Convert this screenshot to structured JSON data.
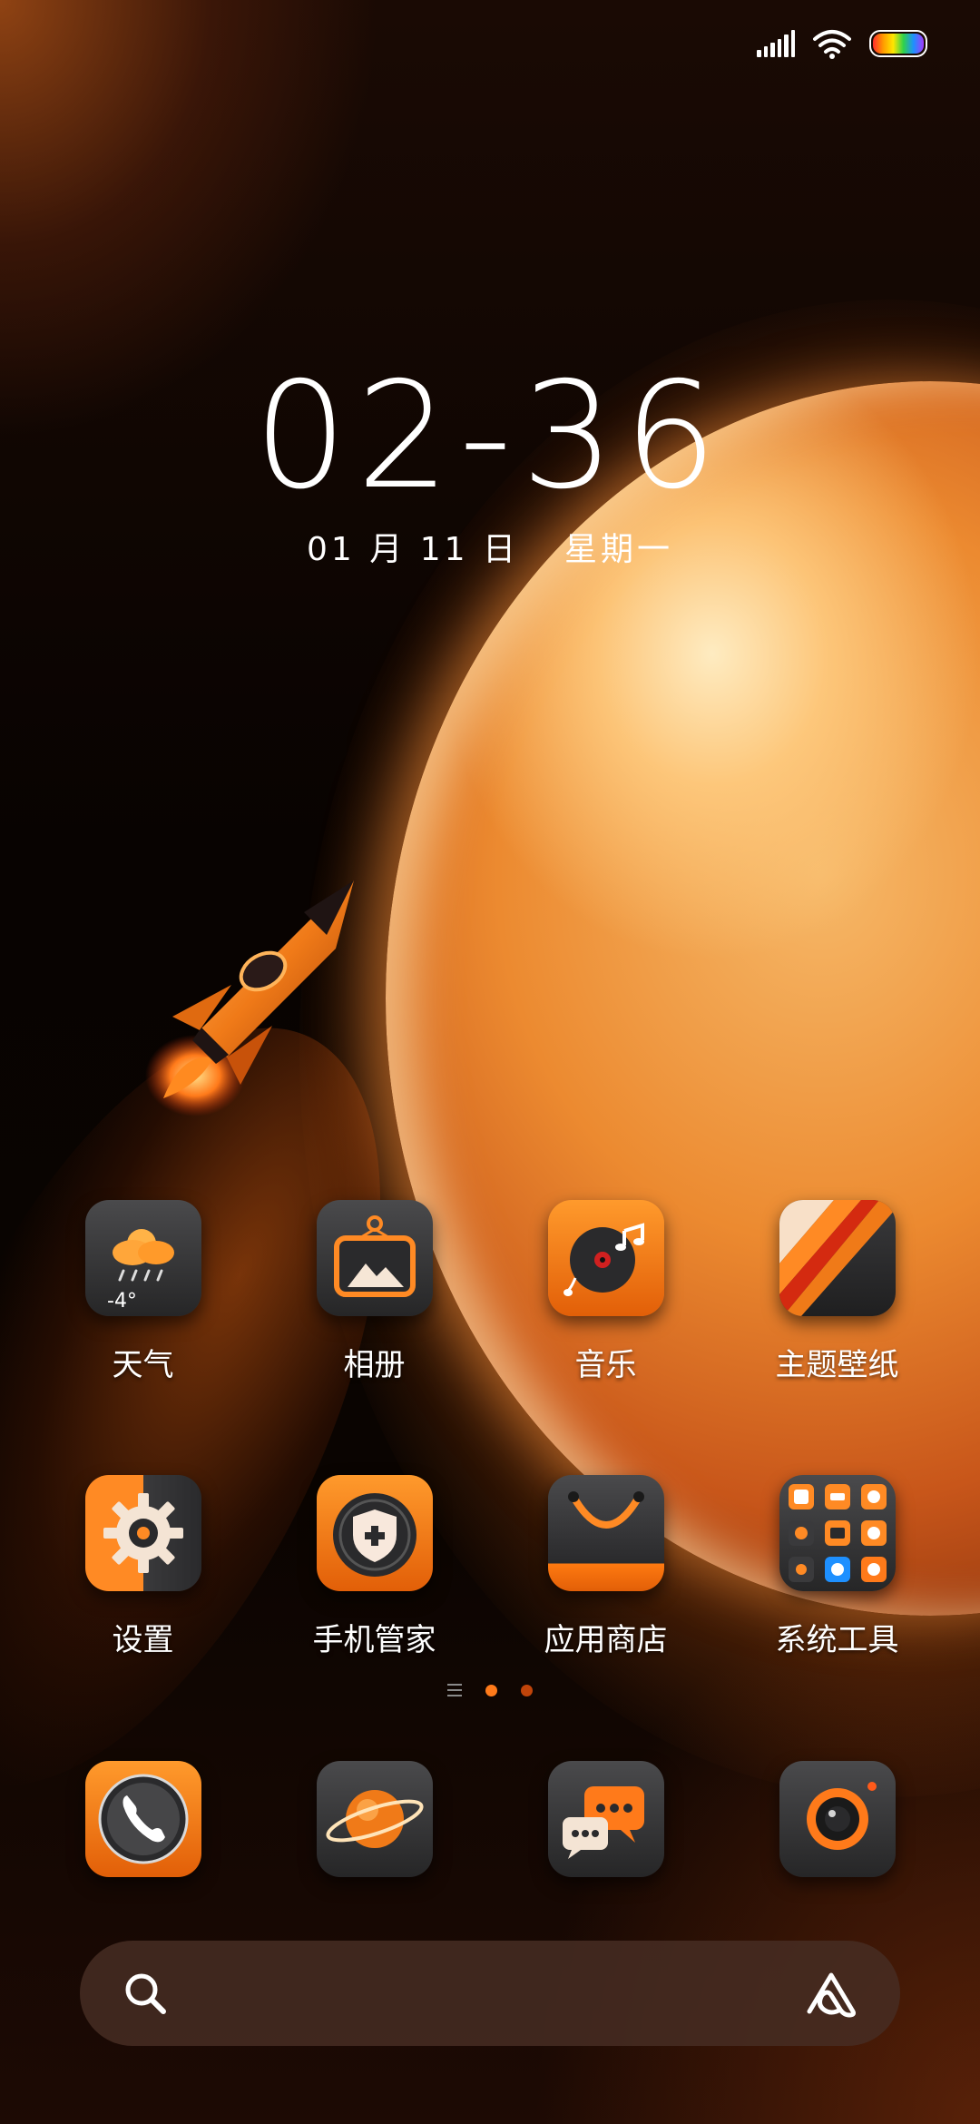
{
  "status_bar": {
    "signal": "signal-icon",
    "wifi": "wifi-icon",
    "battery": "battery-icon"
  },
  "clock": {
    "time": "02-36",
    "date": "01 月 11 日",
    "weekday": "星期一"
  },
  "home": {
    "rows": [
      [
        {
          "label": "天气",
          "icon": "weather-icon",
          "temp": "-4°"
        },
        {
          "label": "相册",
          "icon": "gallery-icon"
        },
        {
          "label": "音乐",
          "icon": "music-icon"
        },
        {
          "label": "主题壁纸",
          "icon": "themes-icon"
        }
      ],
      [
        {
          "label": "设置",
          "icon": "settings-icon"
        },
        {
          "label": "手机管家",
          "icon": "security-icon"
        },
        {
          "label": "应用商店",
          "icon": "app-store-icon"
        },
        {
          "label": "系统工具",
          "icon": "tools-folder-icon"
        }
      ]
    ]
  },
  "page_indicator": {
    "pages": 2,
    "active": 1
  },
  "dock": [
    {
      "icon": "phone-icon"
    },
    {
      "icon": "browser-planet-icon"
    },
    {
      "icon": "messages-icon"
    },
    {
      "icon": "camera-icon"
    }
  ],
  "search": {
    "placeholder": "",
    "search_icon": "search-icon",
    "assistant_icon": "assistant-icon"
  },
  "colors": {
    "accent": "#ff7a1a",
    "icon_dark": "#2e2e30"
  }
}
